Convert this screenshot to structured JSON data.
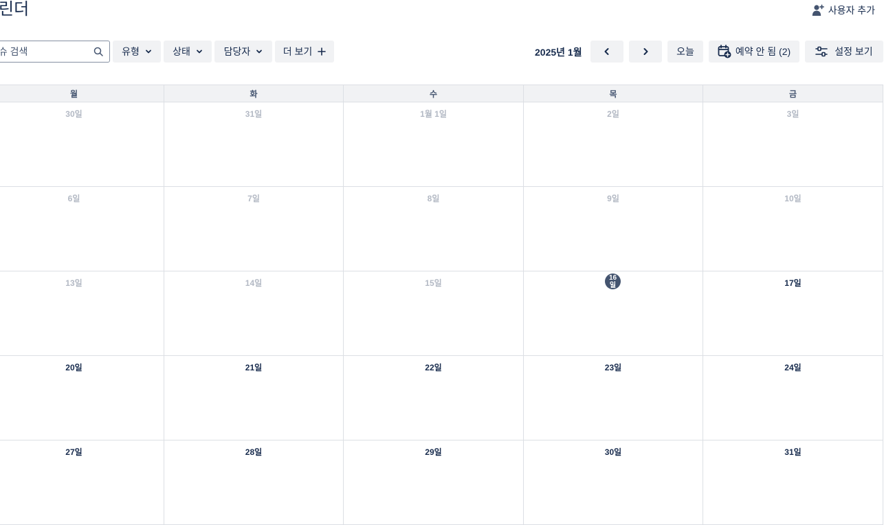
{
  "header": {
    "title": "린더",
    "add_user_label": "사용자 추가"
  },
  "toolbar": {
    "search_placeholder": "이슈 검색",
    "filters": {
      "type": "유형",
      "status": "상태",
      "assignee": "담당자",
      "more": "더 보기"
    },
    "month_label": "2025년 1월",
    "today_label": "오늘",
    "unscheduled_label": "예약 안 됨 (2)",
    "view_settings_label": "설정 보기"
  },
  "calendar": {
    "weekdays": [
      "월",
      "화",
      "수",
      "목",
      "금"
    ],
    "weeks": [
      [
        "30일",
        "31일",
        "1월 1일",
        "2일",
        "3일"
      ],
      [
        "6일",
        "7일",
        "8일",
        "9일",
        "10일"
      ],
      [
        "13일",
        "14일",
        "15일",
        "16일",
        "17일"
      ],
      [
        "20일",
        "21일",
        "22일",
        "23일",
        "24일"
      ],
      [
        "27일",
        "28일",
        "29일",
        "30일",
        "31일"
      ]
    ],
    "today_week": 2,
    "today_day": 3
  },
  "icons": {
    "add_user": "person-plus-icon",
    "search": "search-icon",
    "chevron_down": "chevron-down-icon",
    "plus": "plus-icon",
    "prev": "chevron-left-icon",
    "next": "chevron-right-icon",
    "unscheduled": "calendar-plus-icon",
    "view_settings": "sliders-icon"
  },
  "colors": {
    "today_badge": "#44546f",
    "past_date": "#b3b9c4",
    "text": "#172b4d",
    "button_bg": "#f1f2f4"
  }
}
